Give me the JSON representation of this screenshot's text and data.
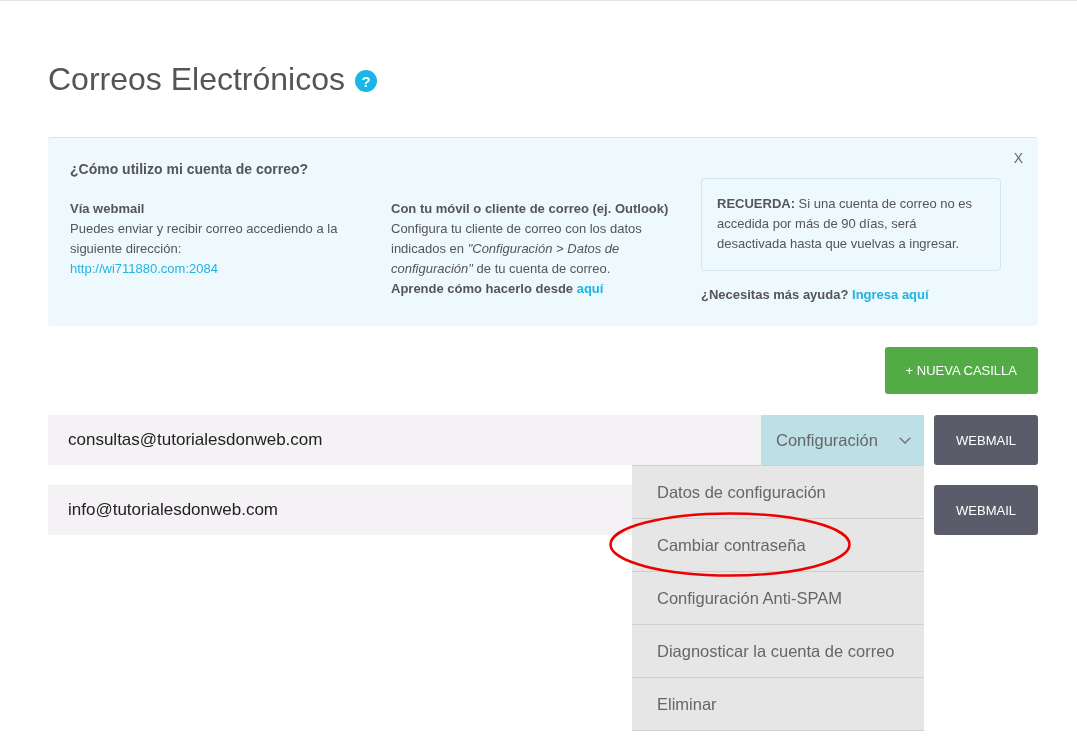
{
  "page": {
    "title": "Correos Electrónicos",
    "help_icon": "?"
  },
  "help_panel": {
    "title": "¿Cómo utilizo mi cuenta de correo?",
    "close": "X",
    "webmail": {
      "heading": "Vía webmail",
      "text": "Puedes enviar y recibir correo accediendo a la siguiente dirección:",
      "link": "http://wi711880.com:2084"
    },
    "client": {
      "heading": "Con tu móvil o cliente de correo (ej. Outlook)",
      "text": "Configura tu cliente de correo con los datos indicados en *\"Configuración > Datos de configuración\"* de tu cuenta de correo.",
      "learn_text": "Aprende cómo hacerlo desde",
      "learn_link": "aquí"
    },
    "reminder": "**RECUERDA:** Si una cuenta de correo no es accedida por más de 90 días, será desactivada hasta que vuelvas a ingresar.",
    "more_help": {
      "text": "¿Necesitas más ayuda?",
      "link": "Ingresa aquí"
    }
  },
  "new_button": "+ NUEVA CASILLA",
  "accounts": [
    {
      "email": "consultas@tutorialesdonweb.com",
      "config_label": "Configuración",
      "expanded": true,
      "webmail_button": "WEBMAIL",
      "menu": [
        {
          "label": "Datos de configuración",
          "highlighted": false
        },
        {
          "label": "Cambiar contraseña",
          "highlighted": true
        },
        {
          "label": "Configuración Anti-SPAM",
          "highlighted": false
        },
        {
          "label": "Diagnosticar la cuenta de correo",
          "highlighted": false
        },
        {
          "label": "Eliminar",
          "highlighted": false
        }
      ]
    },
    {
      "email": "info@tutorialesdonweb.com",
      "webmail_button": "WEBMAIL"
    }
  ]
}
